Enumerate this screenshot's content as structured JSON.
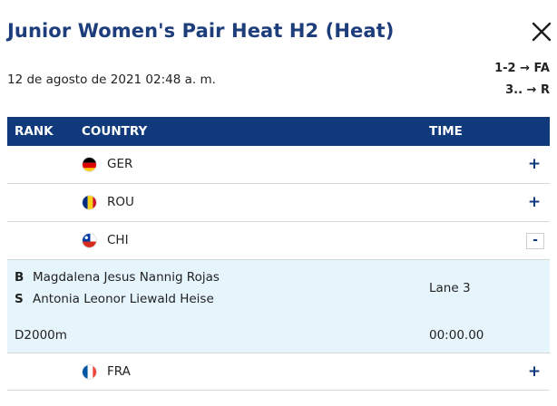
{
  "header": {
    "title": "Junior Women's Pair Heat H2 (Heat)",
    "date": "12 de agosto de 2021 02:48 a. m.",
    "progression": [
      "1-2 → FA",
      "3.. → R"
    ]
  },
  "table": {
    "columns": {
      "rank": "RANK",
      "country": "COUNTRY",
      "time": "TIME"
    },
    "rows": [
      {
        "code": "GER",
        "flag": "germany-flag-icon",
        "toggle": "+"
      },
      {
        "code": "ROU",
        "flag": "romania-flag-icon",
        "toggle": "+"
      },
      {
        "code": "CHI",
        "flag": "chile-flag-icon",
        "toggle": "-"
      },
      {
        "code": "FRA",
        "flag": "france-flag-icon",
        "toggle": "+"
      }
    ],
    "expanded": {
      "crew": [
        {
          "seat": "B",
          "name": "Magdalena Jesus Nannig Rojas"
        },
        {
          "seat": "S",
          "name": "Antonia Leonor Liewald Heise"
        }
      ],
      "lane": "Lane 3",
      "distance": "D2000m",
      "time": "00:00.00"
    }
  },
  "colors": {
    "primary": "#103a7c",
    "title": "#1e3d7b",
    "expanded_bg": "#e6f4fb",
    "divider": "#d7d7d7"
  }
}
